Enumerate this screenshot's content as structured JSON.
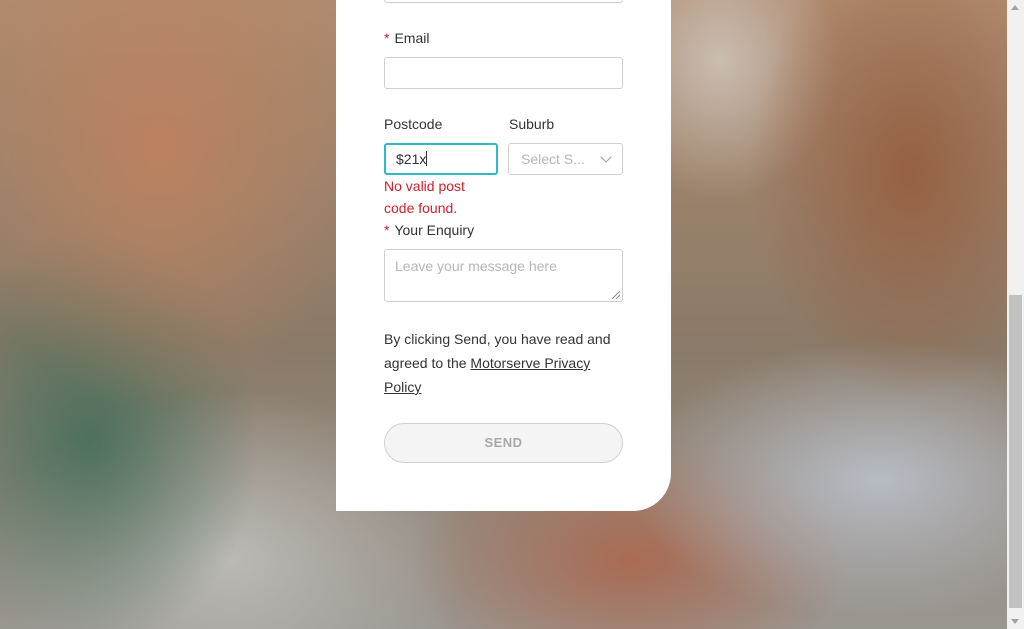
{
  "form": {
    "required_marker": "*",
    "email_label": "Email",
    "email_value": "",
    "postcode_label": "Postcode",
    "postcode_value": "$21x",
    "suburb_label": "Suburb",
    "suburb_placeholder": "Select S...",
    "postcode_error": "No valid post code found.",
    "enquiry_label": "Your Enquiry",
    "enquiry_placeholder": "Leave your message here",
    "consent_text": "By clicking Send, you have read and agreed to the ",
    "privacy_link": "Motorserve Privacy Policy",
    "send_label": "SEND"
  },
  "colors": {
    "accent_focus": "#2bbac6",
    "error": "#d0202e"
  },
  "icons": [
    "chevron-down-icon",
    "resize-grip-icon"
  ]
}
